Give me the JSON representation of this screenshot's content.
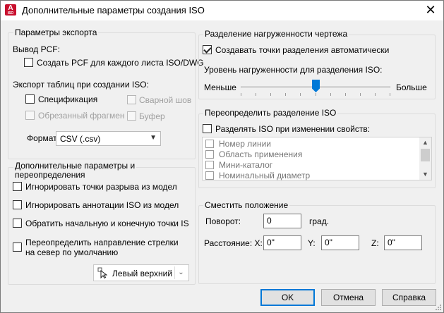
{
  "window": {
    "title": "Дополнительные параметры создания ISO",
    "icon_letter": "A",
    "icon_sub": "ISO"
  },
  "export": {
    "group_title": "Параметры экспорта",
    "pcf_label": "Вывод PCF:",
    "pcf_each_sheet": {
      "label": "Создать PCF для каждого листа ISO/DWG",
      "checked": false
    },
    "tables_label": "Экспорт таблиц при создании ISO:",
    "spec": {
      "label": "Спецификация",
      "checked": false
    },
    "weld": {
      "label": "Сварной шов",
      "checked": false,
      "disabled": true
    },
    "cut": {
      "label": "Обрезанный фрагмен",
      "checked": false,
      "disabled": true
    },
    "buffer": {
      "label": "Буфер",
      "checked": false,
      "disabled": true
    },
    "format_label": "Формат",
    "format_value": "CSV (.csv)"
  },
  "overrides": {
    "group_title_1": "Дополнительные параметры и",
    "group_title_2": "переопределения",
    "ignore_breaks": {
      "label": "Игнорировать точки разрыва из модел",
      "checked": false
    },
    "ignore_annot": {
      "label": "Игнорировать аннотации ISO из модел",
      "checked": false
    },
    "reverse_points": {
      "label": "Обратить начальную и конечную точки IS",
      "checked": false
    },
    "arrow_1": "Переопределить направление стрелки",
    "arrow_2": "на север по умолчанию",
    "arrow_checked": false,
    "position_value": "Левый верхний"
  },
  "density": {
    "group_title": "Разделение нагруженности чертежа",
    "auto": {
      "label": "Создавать точки разделения автоматически",
      "checked": true
    },
    "level_label": "Уровень нагруженности для разделения ISO:",
    "less": "Меньше",
    "more": "Больше",
    "level_fraction": 0.5
  },
  "split": {
    "group_title": "Переопределить разделение ISO",
    "on_change": {
      "label": "Разделять ISO при изменении свойств:",
      "checked": false
    },
    "items": [
      {
        "label": "Номер линии",
        "checked": false
      },
      {
        "label": "Область применения",
        "checked": false
      },
      {
        "label": "Мини-каталог",
        "checked": false
      },
      {
        "label": "Номинальный диаметр",
        "checked": false
      }
    ]
  },
  "offset": {
    "group_title": "Сместить положение",
    "rotation_label": "Поворот:",
    "rotation_value": "0",
    "rotation_unit": "град.",
    "distance_label": "Расстояние: X:",
    "x_value": "0\"",
    "y_label": "Y:",
    "y_value": "0\"",
    "z_label": "Z:",
    "z_value": "0\""
  },
  "buttons": {
    "ok": "OK",
    "cancel": "Отмена",
    "help": "Справка"
  },
  "colors": {
    "accent": "#0078d7",
    "icon_red": "#c8102e"
  }
}
